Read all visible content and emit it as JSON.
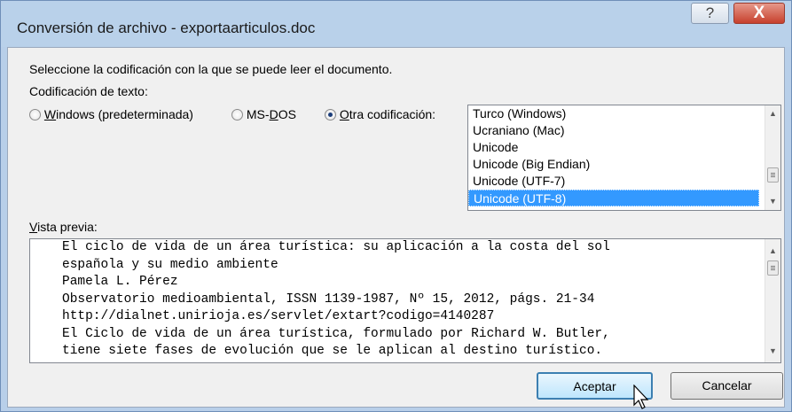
{
  "window": {
    "title": "Conversión de archivo - exportaarticulos.doc",
    "help_glyph": "?",
    "close_glyph": "X"
  },
  "instruction": "Seleccione la codificación con la que se puede leer el documento.",
  "encoding_label": "Codificación de texto:",
  "radios": [
    {
      "mnemonic": "W",
      "rest": "indows (predeterminada)",
      "checked": false
    },
    {
      "prefix": "MS-",
      "mnemonic": "D",
      "rest": "OS",
      "checked": false
    },
    {
      "mnemonic": "O",
      "rest": "tra codificación:",
      "checked": true
    }
  ],
  "encodings": [
    "Turco (Windows)",
    "Ucraniano (Mac)",
    "Unicode",
    "Unicode (Big Endian)",
    "Unicode (UTF-7)",
    "Unicode (UTF-8)"
  ],
  "selected_encoding": "Unicode (UTF-8)",
  "preview": {
    "label_mnemonic": "V",
    "label_rest": "ista previa:",
    "lines": [
      "El ciclo de vida de un área turística: su aplicación a la costa del sol",
      "española y su medio ambiente",
      "Pamela L. Pérez",
      "Observatorio medioambiental, ISSN 1139-1987, Nº 15, 2012, págs. 21-34",
      "http://dialnet.unirioja.es/servlet/extart?codigo=4140287",
      "El Ciclo de vida de un área turística, formulado por Richard W. Butler,",
      "tiene siete fases de evolución que se le aplican al destino turístico."
    ]
  },
  "buttons": {
    "accept": "Aceptar",
    "cancel": "Cancelar"
  },
  "icons": {
    "help": "help-icon",
    "close": "close-icon",
    "scroll_up": "scroll-up-arrow-icon",
    "scroll_down": "scroll-down-arrow-icon",
    "cursor": "mouse-pointer-icon"
  }
}
